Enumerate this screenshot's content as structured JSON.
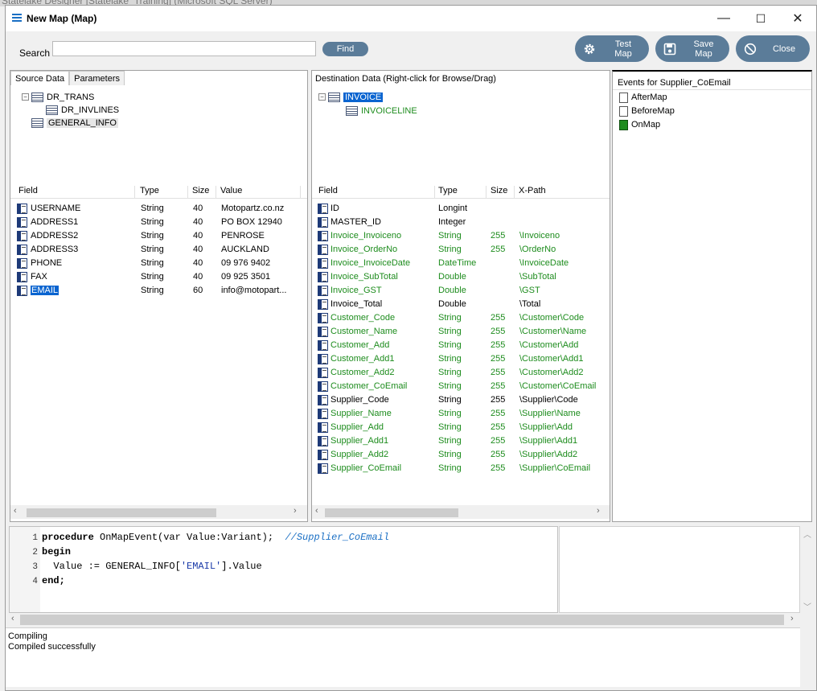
{
  "background_window": {
    "title": "Statelake Designer [Statelake_Training] (Microsoft SQL Server)"
  },
  "window": {
    "title": "New Map (Map)",
    "controls": {
      "minimize": "—",
      "maximize": "☐",
      "close": "✕"
    }
  },
  "toolbar": {
    "search_label": "Search",
    "search_value": "",
    "find_label": "Find",
    "test_map_label": "Test Map",
    "save_map_label": "Save Map",
    "close_label": "Close"
  },
  "source": {
    "tabs": [
      "Source Data",
      "Parameters"
    ],
    "tree": [
      {
        "label": "DR_TRANS",
        "level": 0,
        "expander": "−"
      },
      {
        "label": "DR_INVLINES",
        "level": 1
      },
      {
        "label": "GENERAL_INFO",
        "level": 0
      }
    ],
    "columns": [
      "Field",
      "Type",
      "Size",
      "Value"
    ],
    "rows": [
      {
        "field": "USERNAME",
        "type": "String",
        "size": "40",
        "value": "Motopartz.co.nz"
      },
      {
        "field": "ADDRESS1",
        "type": "String",
        "size": "40",
        "value": "PO BOX 12940"
      },
      {
        "field": "ADDRESS2",
        "type": "String",
        "size": "40",
        "value": "PENROSE"
      },
      {
        "field": "ADDRESS3",
        "type": "String",
        "size": "40",
        "value": "AUCKLAND"
      },
      {
        "field": "PHONE",
        "type": "String",
        "size": "40",
        "value": "09 976 9402"
      },
      {
        "field": "FAX",
        "type": "String",
        "size": "40",
        "value": "09 925 3501"
      },
      {
        "field": "EMAIL",
        "type": "String",
        "size": "60",
        "value": "info@motopart..."
      }
    ]
  },
  "destination": {
    "header": "Destination Data   (Right-click for Browse/Drag)",
    "tree": [
      {
        "label": "INVOICE",
        "level": 0,
        "expander": "−"
      },
      {
        "label": "INVOICELINE",
        "level": 1
      }
    ],
    "columns": [
      "Field",
      "Type",
      "Size",
      "X-Path"
    ],
    "rows": [
      {
        "field": "ID",
        "type": "Longint",
        "size": "",
        "xpath": "",
        "mapped": false
      },
      {
        "field": "MASTER_ID",
        "type": "Integer",
        "size": "",
        "xpath": "",
        "mapped": false
      },
      {
        "field": "Invoice_Invoiceno",
        "type": "String",
        "size": "255",
        "xpath": "\\Invoiceno",
        "mapped": true
      },
      {
        "field": "Invoice_OrderNo",
        "type": "String",
        "size": "255",
        "xpath": "\\OrderNo",
        "mapped": true
      },
      {
        "field": "Invoice_InvoiceDate",
        "type": "DateTime",
        "size": "",
        "xpath": "\\InvoiceDate",
        "mapped": true
      },
      {
        "field": "Invoice_SubTotal",
        "type": "Double",
        "size": "",
        "xpath": "\\SubTotal",
        "mapped": true
      },
      {
        "field": "Invoice_GST",
        "type": "Double",
        "size": "",
        "xpath": "\\GST",
        "mapped": true
      },
      {
        "field": "Invoice_Total",
        "type": "Double",
        "size": "",
        "xpath": "\\Total",
        "mapped": false
      },
      {
        "field": "Customer_Code",
        "type": "String",
        "size": "255",
        "xpath": "\\Customer\\Code",
        "mapped": true
      },
      {
        "field": "Customer_Name",
        "type": "String",
        "size": "255",
        "xpath": "\\Customer\\Name",
        "mapped": true
      },
      {
        "field": "Customer_Add",
        "type": "String",
        "size": "255",
        "xpath": "\\Customer\\Add",
        "mapped": true
      },
      {
        "field": "Customer_Add1",
        "type": "String",
        "size": "255",
        "xpath": "\\Customer\\Add1",
        "mapped": true
      },
      {
        "field": "Customer_Add2",
        "type": "String",
        "size": "255",
        "xpath": "\\Customer\\Add2",
        "mapped": true
      },
      {
        "field": "Customer_CoEmail",
        "type": "String",
        "size": "255",
        "xpath": "\\Customer\\CoEmail",
        "mapped": true
      },
      {
        "field": "Supplier_Code",
        "type": "String",
        "size": "255",
        "xpath": "\\Supplier\\Code",
        "mapped": false
      },
      {
        "field": "Supplier_Name",
        "type": "String",
        "size": "255",
        "xpath": "\\Supplier\\Name",
        "mapped": true
      },
      {
        "field": "Supplier_Add",
        "type": "String",
        "size": "255",
        "xpath": "\\Supplier\\Add",
        "mapped": true
      },
      {
        "field": "Supplier_Add1",
        "type": "String",
        "size": "255",
        "xpath": "\\Supplier\\Add1",
        "mapped": true
      },
      {
        "field": "Supplier_Add2",
        "type": "String",
        "size": "255",
        "xpath": "\\Supplier\\Add2",
        "mapped": true
      },
      {
        "field": "Supplier_CoEmail",
        "type": "String",
        "size": "255",
        "xpath": "\\Supplier\\CoEmail",
        "mapped": true
      }
    ]
  },
  "events": {
    "title": "Events for Supplier_CoEmail",
    "items": [
      {
        "label": "AfterMap",
        "active": false
      },
      {
        "label": "BeforeMap",
        "active": false
      },
      {
        "label": "OnMap",
        "active": true
      }
    ]
  },
  "editor": {
    "line_numbers": [
      "1",
      "2",
      "3",
      "4"
    ],
    "line1_kw": "procedure",
    "line1_rest": " OnMapEvent(var Value:Variant);  ",
    "line1_comment": "//Supplier_CoEmail",
    "line2_kw": "begin",
    "line3_pre": "  Value := GENERAL_INFO[",
    "line3_str": "'EMAIL'",
    "line3_post": "].Value",
    "line4_kw": "end;"
  },
  "messages": [
    "Compiling",
    "Compiled successfully"
  ],
  "colors": {
    "accent": "#5b7c99",
    "mapped_text": "#1d8c1d",
    "selection": "#0a64d0"
  },
  "icons": {
    "test_map": "gear-icon",
    "save_map": "save-icon",
    "close": "cancel-icon"
  }
}
